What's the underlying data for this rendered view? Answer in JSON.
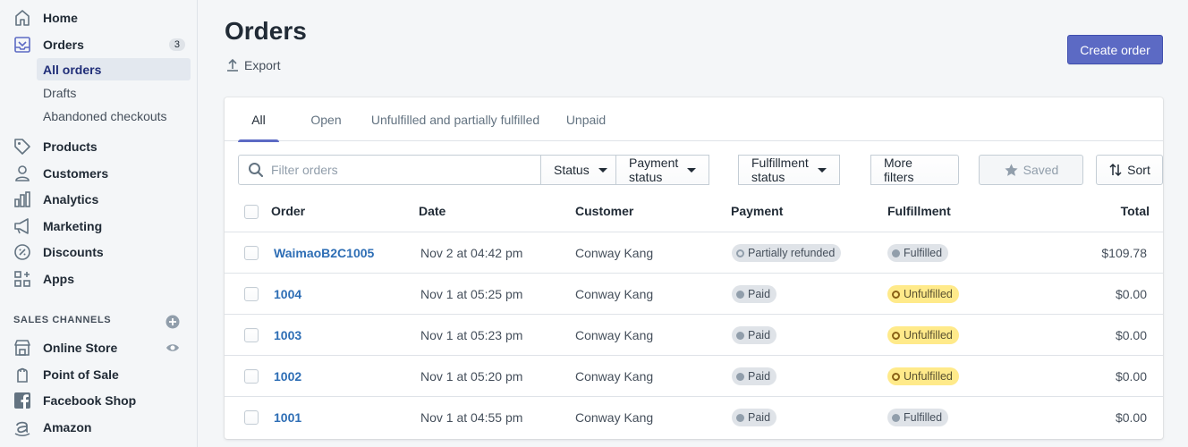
{
  "sidebar": {
    "items": [
      {
        "label": "Home",
        "icon": "home-icon"
      },
      {
        "label": "Orders",
        "icon": "orders-icon",
        "count": "3"
      },
      {
        "label": "Products",
        "icon": "tag-icon"
      },
      {
        "label": "Customers",
        "icon": "customer-icon"
      },
      {
        "label": "Analytics",
        "icon": "analytics-icon"
      },
      {
        "label": "Marketing",
        "icon": "megaphone-icon"
      },
      {
        "label": "Discounts",
        "icon": "discount-icon"
      },
      {
        "label": "Apps",
        "icon": "apps-icon"
      }
    ],
    "sub_items": [
      "All orders",
      "Drafts",
      "Abandoned checkouts"
    ],
    "channels_heading": "SALES CHANNELS",
    "channels": [
      {
        "label": "Online Store",
        "icon": "store-icon"
      },
      {
        "label": "Point of Sale",
        "icon": "pos-icon"
      },
      {
        "label": "Facebook Shop",
        "icon": "facebook-icon"
      },
      {
        "label": "Amazon",
        "icon": "amazon-icon"
      }
    ]
  },
  "header": {
    "title": "Orders",
    "export_label": "Export",
    "create_label": "Create order"
  },
  "tabs": [
    "All",
    "Open",
    "Unfulfilled and partially fulfilled",
    "Unpaid"
  ],
  "filters": {
    "search_placeholder": "Filter orders",
    "status": "Status",
    "payment_status": "Payment status",
    "fulfillment_status": "Fulfillment status",
    "more_filters": "More filters",
    "saved": "Saved",
    "sort": "Sort"
  },
  "table": {
    "columns": [
      "Order",
      "Date",
      "Customer",
      "Payment",
      "Fulfillment",
      "Total"
    ],
    "rows": [
      {
        "order": "WaimaoB2C1005",
        "date": "Nov 2 at 04:42 pm",
        "customer": "Conway Kang",
        "payment": "Partially refunded",
        "fulfillment": "Fulfilled",
        "total": "$109.78"
      },
      {
        "order": "1004",
        "date": "Nov 1 at 05:25 pm",
        "customer": "Conway Kang",
        "payment": "Paid",
        "fulfillment": "Unfulfilled",
        "total": "$0.00"
      },
      {
        "order": "1003",
        "date": "Nov 1 at 05:23 pm",
        "customer": "Conway Kang",
        "payment": "Paid",
        "fulfillment": "Unfulfilled",
        "total": "$0.00"
      },
      {
        "order": "1002",
        "date": "Nov 1 at 05:20 pm",
        "customer": "Conway Kang",
        "payment": "Paid",
        "fulfillment": "Unfulfilled",
        "total": "$0.00"
      },
      {
        "order": "1001",
        "date": "Nov 1 at 04:55 pm",
        "customer": "Conway Kang",
        "payment": "Paid",
        "fulfillment": "Fulfilled",
        "total": "$0.00"
      }
    ]
  },
  "colors": {
    "accent": "#5c6ac4",
    "link": "#2e6eb5",
    "unfulfilled_badge": "#ffea8a",
    "neutral_badge": "#dfe3e8"
  }
}
